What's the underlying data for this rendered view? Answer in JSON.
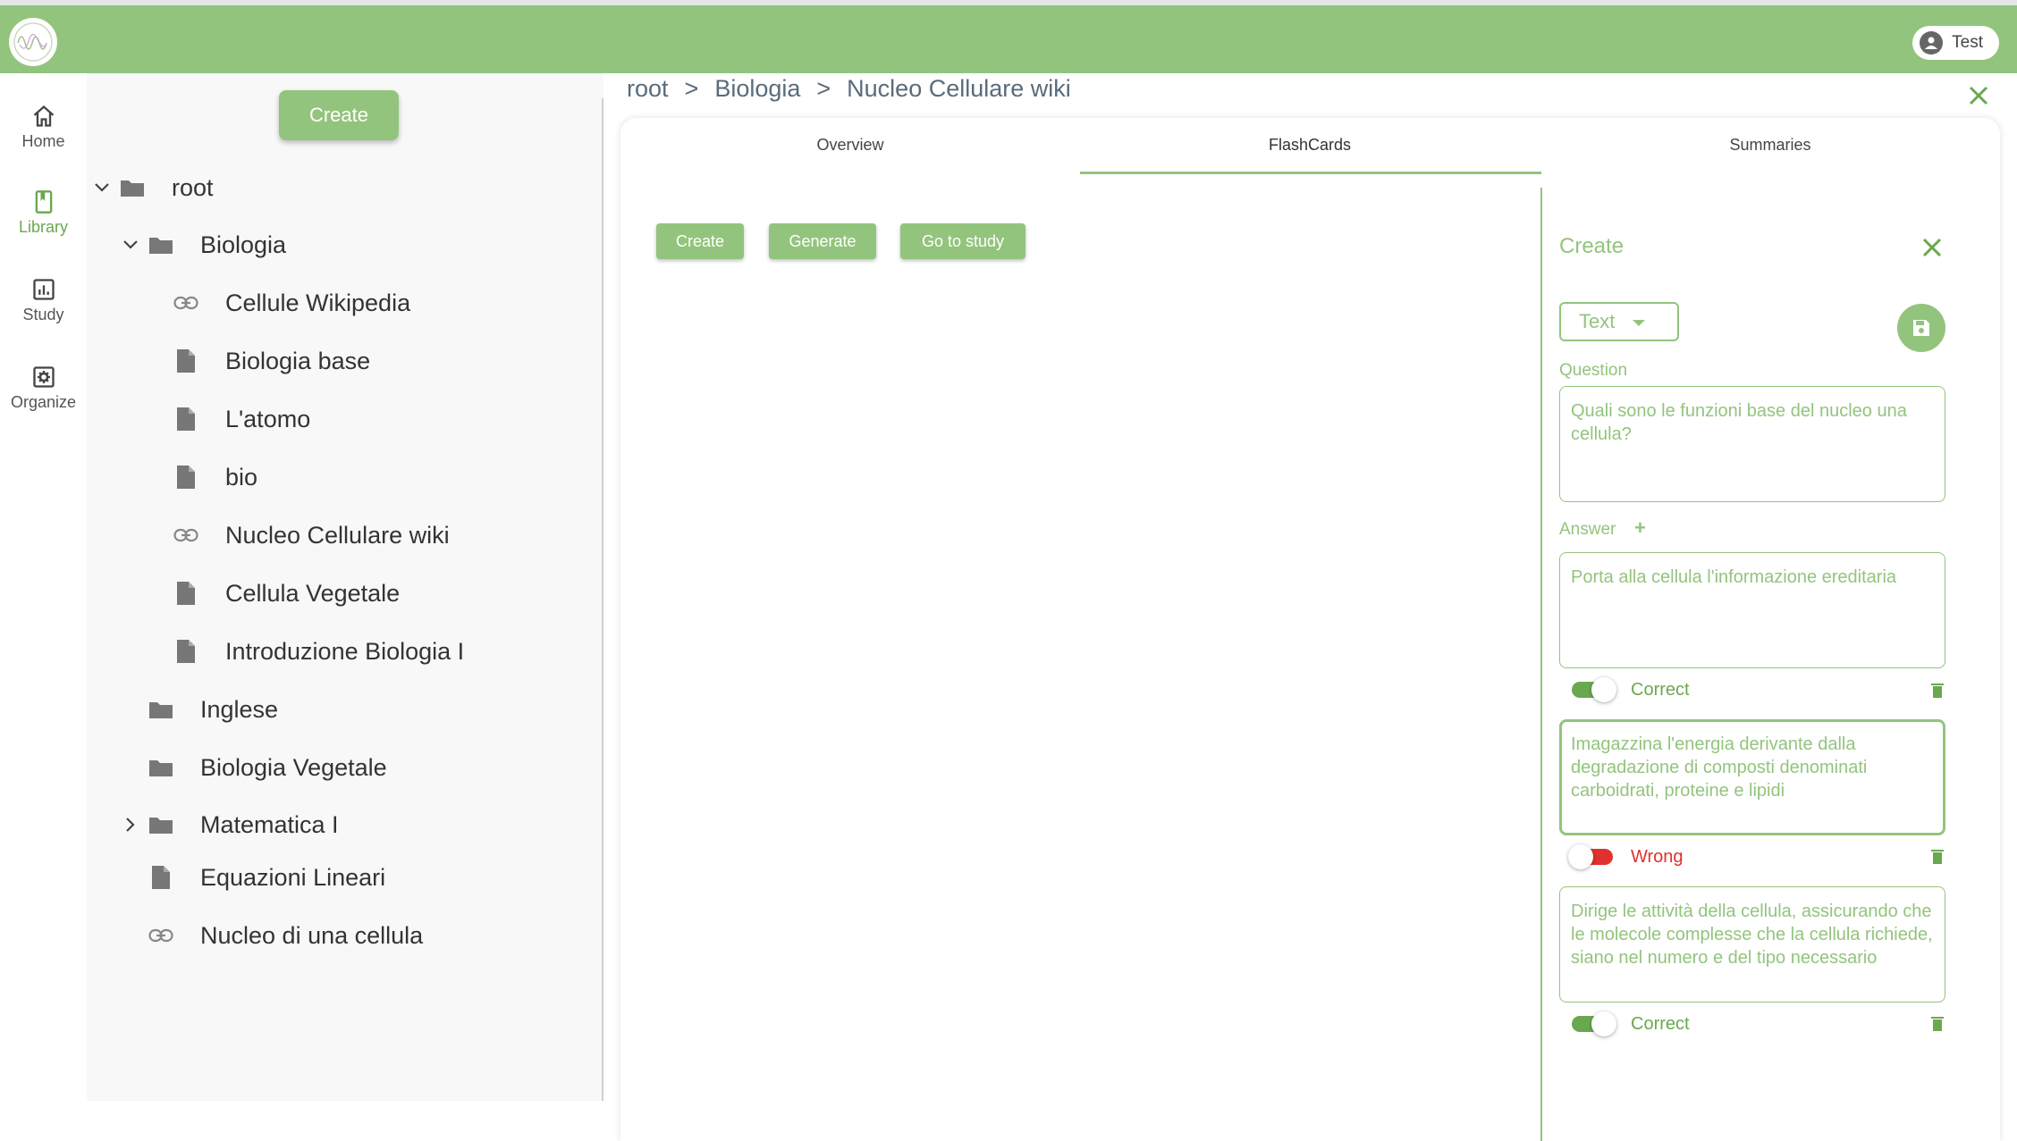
{
  "header": {
    "user_label": "Test"
  },
  "nav": [
    {
      "label": "Home",
      "icon": "home-icon",
      "active": false
    },
    {
      "label": "Library",
      "icon": "book-icon",
      "active": true
    },
    {
      "label": "Study",
      "icon": "chart-icon",
      "active": false
    },
    {
      "label": "Organize",
      "icon": "gear-icon",
      "active": false
    }
  ],
  "tree": {
    "create_label": "Create",
    "items": [
      {
        "label": "root",
        "type": "folder",
        "expanded": true
      },
      {
        "label": "Biologia",
        "type": "folder",
        "expanded": true
      },
      {
        "label": "Cellule Wikipedia",
        "type": "link"
      },
      {
        "label": "Biologia base",
        "type": "file"
      },
      {
        "label": "L'atomo",
        "type": "file"
      },
      {
        "label": "bio",
        "type": "file"
      },
      {
        "label": "Nucleo Cellulare wiki",
        "type": "link"
      },
      {
        "label": "Cellula Vegetale",
        "type": "file"
      },
      {
        "label": "Introduzione Biologia I",
        "type": "file"
      },
      {
        "label": "Inglese",
        "type": "folder"
      },
      {
        "label": "Biologia Vegetale",
        "type": "folder"
      },
      {
        "label": "Matematica I",
        "type": "folder",
        "expanded": false
      },
      {
        "label": "Equazioni Lineari",
        "type": "file"
      },
      {
        "label": "Nucleo di una cellula",
        "type": "link"
      }
    ]
  },
  "breadcrumb": {
    "items": [
      "root",
      "Biologia",
      "Nucleo Cellulare wiki"
    ],
    "separator": ">"
  },
  "tabs": [
    {
      "label": "Overview",
      "active": false
    },
    {
      "label": "FlashCards",
      "active": true
    },
    {
      "label": "Summaries",
      "active": false
    }
  ],
  "actions": {
    "create": "Create",
    "generate": "Generate",
    "go_to_study": "Go to study"
  },
  "panel": {
    "title": "Create",
    "type_value": "Text",
    "question_label": "Question",
    "question": "Quali sono le funzioni base del nucleo una cellula?",
    "answer_label": "Answer",
    "answers": [
      {
        "text": "Porta alla cellula l'informazione ereditaria",
        "status": "Correct",
        "correct": true
      },
      {
        "text": "Imagazzina l'energia derivante dalla degradazione di composti denominati carboidrati, proteine e lipidi",
        "status": "Wrong",
        "correct": false
      },
      {
        "text": "Dirige le attività della cellula, assicurando che le molecole complesse che la cellula richiede, siano nel numero e del tipo necessario",
        "status": "Correct",
        "correct": true
      }
    ]
  },
  "colors": {
    "accent": "#93c47d",
    "accent_dark": "#6aa84f",
    "wrong": "#e0312e"
  }
}
